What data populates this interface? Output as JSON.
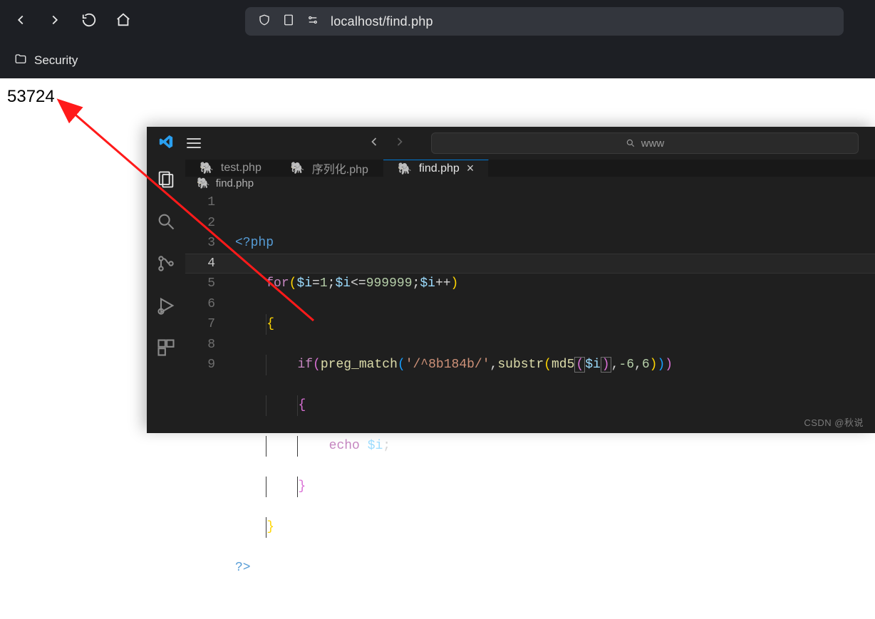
{
  "browser": {
    "url": "localhost/find.php",
    "bookmark_label": "Security",
    "page_body": "53724"
  },
  "vscode": {
    "search_placeholder": "www",
    "tabs": [
      {
        "label": "test.php",
        "active": false
      },
      {
        "label": "序列化.php",
        "active": false
      },
      {
        "label": "find.php",
        "active": true
      }
    ],
    "breadcrumb_file": "find.php",
    "line_numbers": [
      "1",
      "2",
      "3",
      "4",
      "5",
      "6",
      "7",
      "8",
      "9"
    ],
    "current_line_index": 3,
    "code": {
      "l1_open": "<?php",
      "l2_for": "for",
      "l2_var": "$i",
      "l2_eq": "=",
      "l2_one": "1",
      "l2_cmp": "<=",
      "l2_limit": "999999",
      "l2_inc": "++",
      "l4_if": "if",
      "l4_fn1": "preg_match",
      "l4_str": "'/^8b184b/'",
      "l4_fn2": "substr",
      "l4_fn3": "md5",
      "l4_n6a": "-6",
      "l4_n6b": "6",
      "l6_echo": "echo",
      "l9_close": "?>"
    }
  },
  "watermark": "CSDN @秋说"
}
